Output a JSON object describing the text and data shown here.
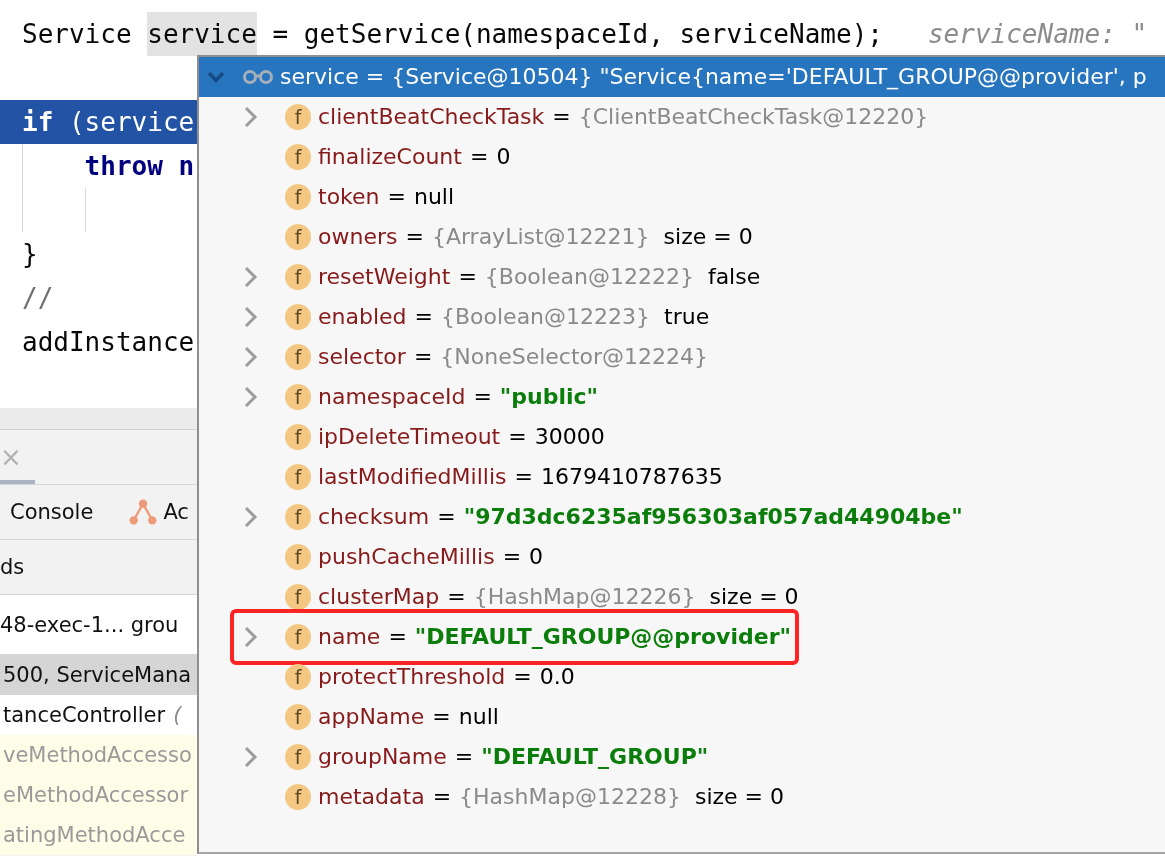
{
  "editor": {
    "lines": [
      {
        "selected": false,
        "tokens": [
          {
            "kind": "plain",
            "text": "Service "
          },
          {
            "kind": "usage",
            "text": "service"
          },
          {
            "kind": "plain",
            "text": " = getService(namespaceId, serviceName);"
          },
          {
            "kind": "hint",
            "text": "serviceName: \""
          }
        ]
      },
      {
        "selected": false
      },
      {
        "selected": true,
        "tokens": [
          {
            "kind": "keyword",
            "text": "if"
          },
          {
            "kind": "plain",
            "text": " (service"
          }
        ],
        "children": [
          {
            "selected": false,
            "tokens": [
              {
                "kind": "keyword",
                "text": "throw n"
              }
            ],
            "children": [
              {
                "selected": false
              }
            ]
          }
        ]
      },
      {
        "selected": false,
        "tokens": [
          {
            "kind": "plain",
            "text": "}"
          }
        ]
      },
      {
        "selected": false,
        "tokens": [
          {
            "kind": "comment",
            "text": "//"
          }
        ]
      },
      {
        "selected": false,
        "tokens": [
          {
            "kind": "plain",
            "text": "addInstance"
          }
        ]
      }
    ]
  },
  "debug_panel": {
    "tab": {
      "close_glyph": "×",
      "selected": true
    },
    "toolbar": [
      {
        "kind": "plain",
        "label": "Console"
      },
      {
        "kind": "with_icon",
        "label": "Ac"
      }
    ],
    "frames_header": "ds",
    "thread_selector": "48-exec-1... grou",
    "frames": [
      {
        "text": "500, ServiceMana",
        "selected": true,
        "library": false
      },
      {
        "text": "tanceController",
        "location": "(",
        "selected": false,
        "library": false
      },
      {
        "text": "veMethodAccesso",
        "selected": false,
        "library": true
      },
      {
        "text": "eMethodAccessor",
        "selected": false,
        "library": true
      },
      {
        "text": "atingMethodAcce",
        "selected": false,
        "library": true
      }
    ]
  },
  "popup": {
    "header": {
      "expanded": true,
      "text": "service = {Service@10504} \"Service{name='DEFAULT_GROUP@@provider', p"
    },
    "fields": [
      {
        "badge": "f",
        "name": "clientBeatCheckTask",
        "op": "=",
        "value": [
          {
            "kind": "ref",
            "text": "{ClientBeatCheckTask@12220}"
          }
        ],
        "expandable": true,
        "annotated": false
      },
      {
        "badge": "f",
        "name": "finalizeCount",
        "op": "=",
        "value": [
          {
            "kind": "plain",
            "text": "0"
          }
        ],
        "expandable": false,
        "annotated": false
      },
      {
        "badge": "f",
        "name": "token",
        "op": "=",
        "value": [
          {
            "kind": "plain",
            "text": "null"
          }
        ],
        "expandable": false,
        "annotated": false
      },
      {
        "badge": "f",
        "name": "owners",
        "op": "=",
        "value": [
          {
            "kind": "ref",
            "text": "{ArrayList@12221}"
          },
          {
            "kind": "plain",
            "text": "size = 0"
          }
        ],
        "expandable": false,
        "annotated": false
      },
      {
        "badge": "f",
        "name": "resetWeight",
        "op": "=",
        "value": [
          {
            "kind": "ref",
            "text": "{Boolean@12222}"
          },
          {
            "kind": "plain",
            "text": "false"
          }
        ],
        "expandable": true,
        "annotated": false
      },
      {
        "badge": "f",
        "name": "enabled",
        "op": "=",
        "value": [
          {
            "kind": "ref",
            "text": "{Boolean@12223}"
          },
          {
            "kind": "plain",
            "text": "true"
          }
        ],
        "expandable": true,
        "annotated": false
      },
      {
        "badge": "f",
        "name": "selector",
        "op": "=",
        "value": [
          {
            "kind": "ref",
            "text": "{NoneSelector@12224}"
          }
        ],
        "expandable": true,
        "annotated": false
      },
      {
        "badge": "f",
        "name": "namespaceId",
        "op": "=",
        "value": [
          {
            "kind": "string",
            "text": "\"public\""
          }
        ],
        "expandable": true,
        "annotated": false
      },
      {
        "badge": "f",
        "name": "ipDeleteTimeout",
        "op": "=",
        "value": [
          {
            "kind": "plain",
            "text": "30000"
          }
        ],
        "expandable": false,
        "annotated": false
      },
      {
        "badge": "f",
        "name": "lastModifiedMillis",
        "op": "=",
        "value": [
          {
            "kind": "plain",
            "text": "1679410787635"
          }
        ],
        "expandable": false,
        "annotated": false
      },
      {
        "badge": "f",
        "name": "checksum",
        "op": "=",
        "value": [
          {
            "kind": "string",
            "text": "\"97d3dc6235af956303af057ad44904be\""
          }
        ],
        "expandable": true,
        "annotated": false
      },
      {
        "badge": "f",
        "name": "pushCacheMillis",
        "op": "=",
        "value": [
          {
            "kind": "plain",
            "text": "0"
          }
        ],
        "expandable": false,
        "annotated": false
      },
      {
        "badge": "f",
        "name": "clusterMap",
        "op": "=",
        "value": [
          {
            "kind": "ref",
            "text": "{HashMap@12226}"
          },
          {
            "kind": "plain",
            "text": "size = 0"
          }
        ],
        "expandable": false,
        "annotated": false
      },
      {
        "badge": "f",
        "name": "name",
        "op": "=",
        "value": [
          {
            "kind": "string",
            "text": "\"DEFAULT_GROUP@@provider\""
          }
        ],
        "expandable": true,
        "annotated": true
      },
      {
        "badge": "f",
        "name": "protectThreshold",
        "op": "=",
        "value": [
          {
            "kind": "plain",
            "text": "0.0"
          }
        ],
        "expandable": false,
        "annotated": false
      },
      {
        "badge": "f",
        "name": "appName",
        "op": "=",
        "value": [
          {
            "kind": "plain",
            "text": "null"
          }
        ],
        "expandable": false,
        "annotated": false
      },
      {
        "badge": "f",
        "name": "groupName",
        "op": "=",
        "value": [
          {
            "kind": "string",
            "text": "\"DEFAULT_GROUP\""
          }
        ],
        "expandable": true,
        "annotated": false
      },
      {
        "badge": "f",
        "name": "metadata",
        "op": "=",
        "value": [
          {
            "kind": "ref",
            "text": "{HashMap@12228}"
          },
          {
            "kind": "plain",
            "text": "size = 0"
          }
        ],
        "expandable": false,
        "annotated": false
      }
    ]
  }
}
